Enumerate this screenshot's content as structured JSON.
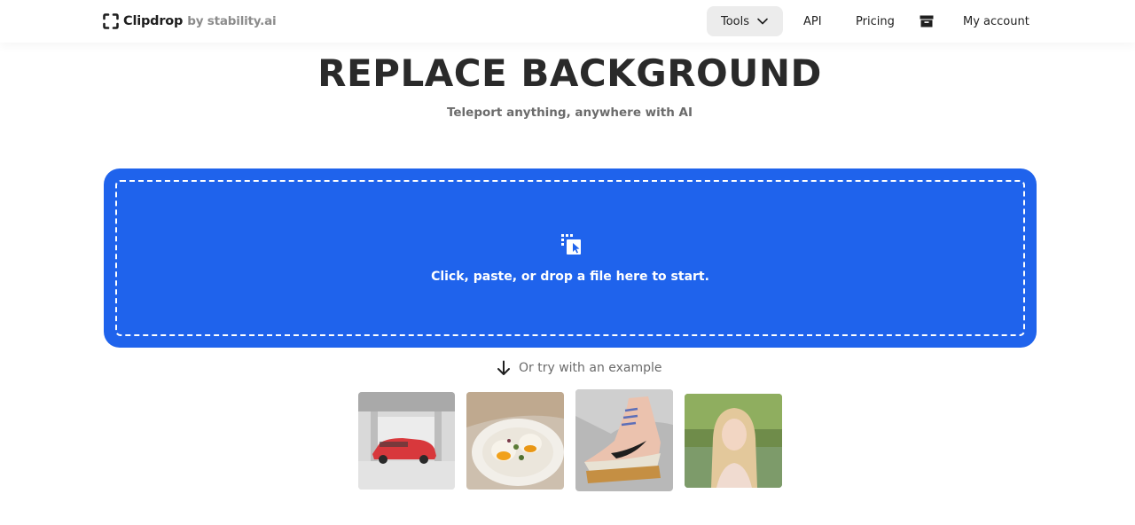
{
  "header": {
    "logo": {
      "name": "Clipdrop",
      "by": "by stability.ai",
      "icon": "clipdrop-bracket-icon"
    },
    "nav": {
      "tools_label": "Tools",
      "tools_icon": "chevron-down-icon",
      "api_label": "API",
      "pricing_label": "Pricing",
      "archive_icon": "archive-box-icon",
      "account_label": "My account"
    }
  },
  "hero": {
    "title": "REPLACE BACKGROUND",
    "subtitle": "Teleport anything, anywhere with AI"
  },
  "dropzone": {
    "icon": "upload-cursor-icon",
    "text": "Click, paste, or drop a file here to start.",
    "background_color": "#1f63ec"
  },
  "examples": {
    "label": "Or try with an example",
    "icon": "arrow-down-icon",
    "items": [
      {
        "subject": "red sports car in garage"
      },
      {
        "subject": "plate of eggs benedict"
      },
      {
        "subject": "high-top sneaker"
      },
      {
        "subject": "portrait of woman outdoors"
      }
    ]
  },
  "colors": {
    "accent": "#1f63ec",
    "text_primary": "#2a2a2a",
    "text_muted": "#6b6b6b",
    "nav_active_bg": "#ececec"
  }
}
